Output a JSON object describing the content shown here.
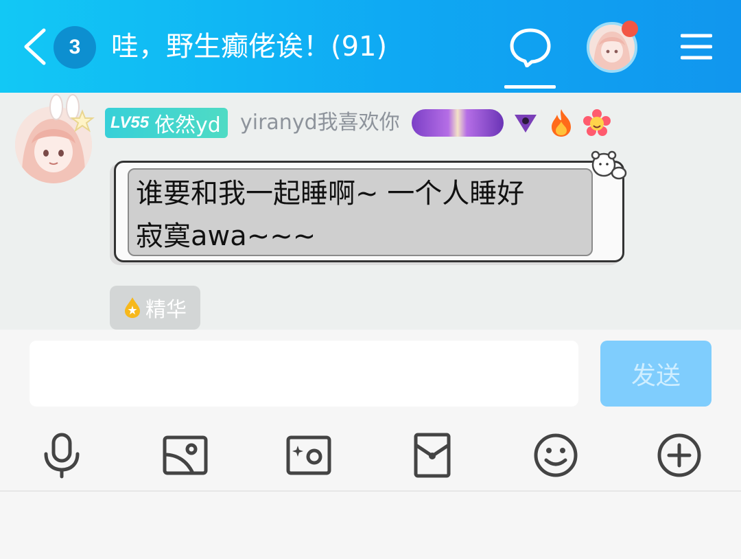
{
  "header": {
    "unread_count": "3",
    "title": "哇，野生癫佬诶！(91)"
  },
  "message": {
    "level": "LV55",
    "nickname": "依然yd",
    "member_title": "yiranyd我喜欢你",
    "text_line1": "谁要和我一起睡啊~ 一个人睡好",
    "text_line2": "寂寞awa~~~",
    "essence_label": "精华"
  },
  "input": {
    "value": "",
    "send_label": "发送"
  },
  "toolbar": [
    "microphone-icon",
    "image-icon",
    "camera-icon",
    "red-packet-icon",
    "emoji-icon",
    "plus-icon"
  ],
  "colors": {
    "header_start": "#12c8f5",
    "header_end": "#1196ee",
    "send_button": "#7fcdfd",
    "notification_dot": "#f25645",
    "level_badge": "#37d0d8"
  }
}
